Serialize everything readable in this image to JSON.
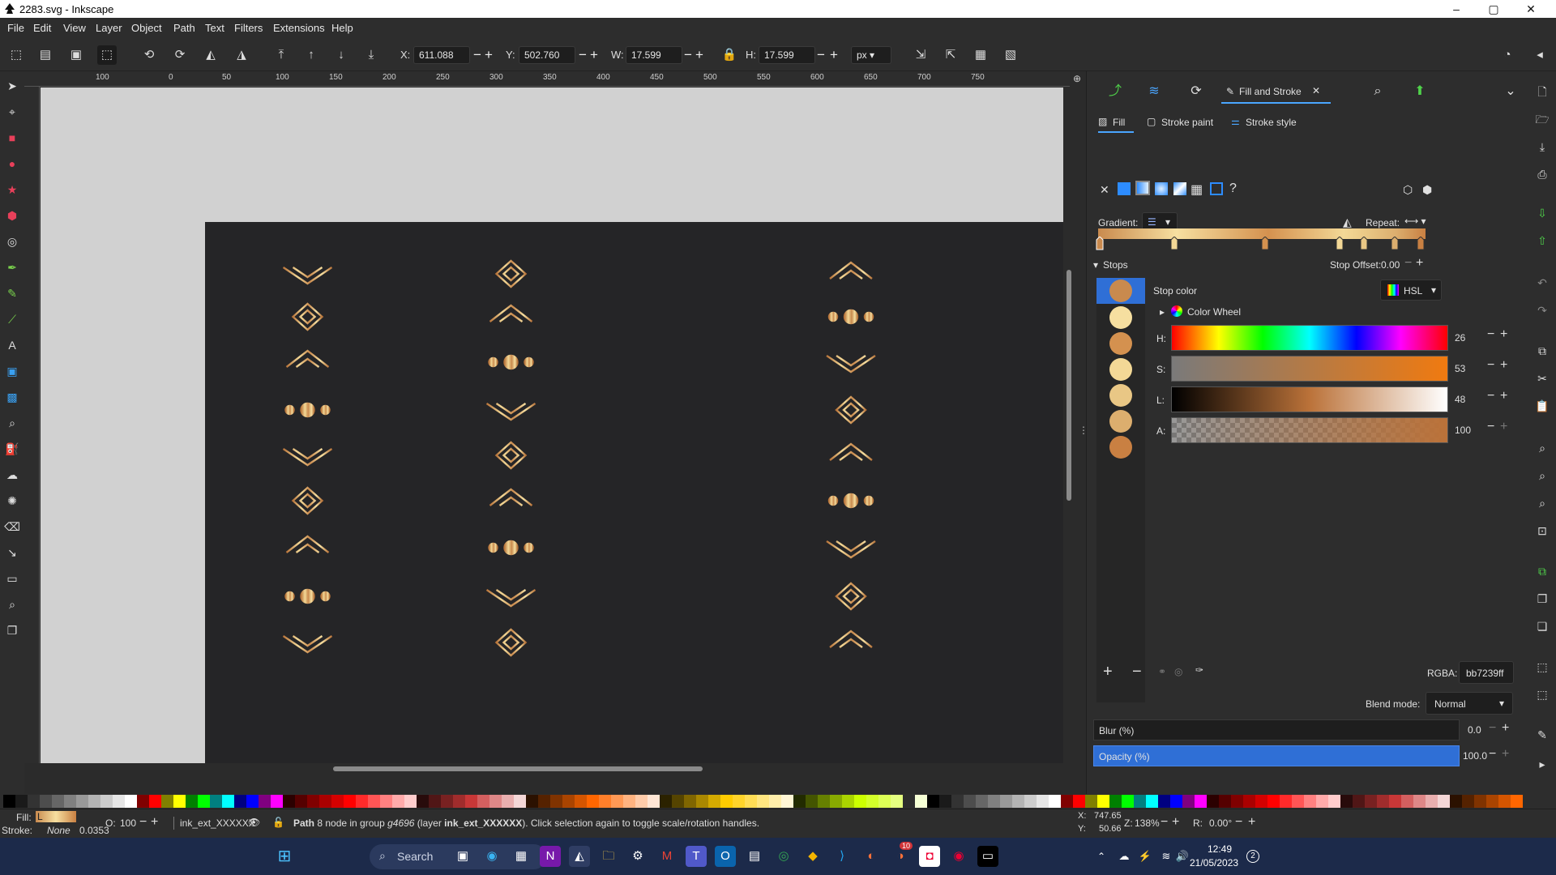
{
  "window": {
    "title": "2283.svg - Inkscape",
    "minimize": "–",
    "maximize": "▢",
    "close": "✕"
  },
  "menu": [
    "File",
    "Edit",
    "View",
    "Layer",
    "Object",
    "Path",
    "Text",
    "Filters",
    "Extensions",
    "Help"
  ],
  "toolbar": {
    "x_label": "X:",
    "x_value": "611.088",
    "y_label": "Y:",
    "y_value": "502.760",
    "w_label": "W:",
    "w_value": "17.599",
    "h_label": "H:",
    "h_value": "17.599",
    "unit": "px"
  },
  "ruler": {
    "labels": [
      "100",
      "0",
      "50",
      "100",
      "150",
      "200",
      "250",
      "300",
      "350",
      "400",
      "450",
      "500",
      "550",
      "600",
      "650",
      "700",
      "750"
    ]
  },
  "dock": {
    "tab_active": "Fill and Stroke",
    "fill_tab": "Fill",
    "stroke_paint_tab": "Stroke paint",
    "stroke_style_tab": "Stroke style",
    "gradient_label": "Gradient:",
    "repeat_label": "Repeat:",
    "stops_label": "Stops",
    "stop_offset_label": "Stop Offset:",
    "stop_offset_value": "0.00",
    "stop_color_label": "Stop color",
    "color_mode": "HSL",
    "color_wheel_label": "Color Wheel",
    "h_label": "H:",
    "h_value": "26",
    "s_label": "S:",
    "s_value": "53",
    "l_label": "L:",
    "l_value": "48",
    "a_label": "A:",
    "a_value": "100",
    "rgba_label": "RGBA:",
    "rgba_value": "bb7239ff",
    "blend_label": "Blend mode:",
    "blend_value": "Normal",
    "blur_label": "Blur (%)",
    "blur_value": "0.0",
    "opacity_label": "Opacity (%)",
    "opacity_value": "100.0",
    "stop_colors": [
      "#c98a4e",
      "#f6dfa0",
      "#d4914f",
      "#f3d896",
      "#e9c785",
      "#dcae6e",
      "#c98042"
    ]
  },
  "status": {
    "fill_label": "Fill:",
    "fill_value": "L",
    "stroke_label": "Stroke:",
    "stroke_value": "None",
    "stroke_width": "0.0353",
    "opacity_label": "O:",
    "opacity_value": "100",
    "layer_name": "ink_ext_XXXXXX",
    "message_bold": "Path",
    "message_1": " 8 node in group ",
    "message_group": "g4696",
    "message_2": " (layer ",
    "message_layer": "ink_ext_XXXXXX",
    "message_3": "). Click selection again to toggle scale/rotation handles.",
    "x_label": "X:",
    "x_value": "747.65",
    "y_label": "Y:",
    "y_value": "50.66",
    "zoom_label": "Z:",
    "zoom_value": "138%",
    "rot_label": "R:",
    "rot_value": "0.00°"
  },
  "taskbar": {
    "search_placeholder": "Search",
    "time": "12:49",
    "date": "21/05/2023",
    "notif_count": "2",
    "badge": "10"
  }
}
